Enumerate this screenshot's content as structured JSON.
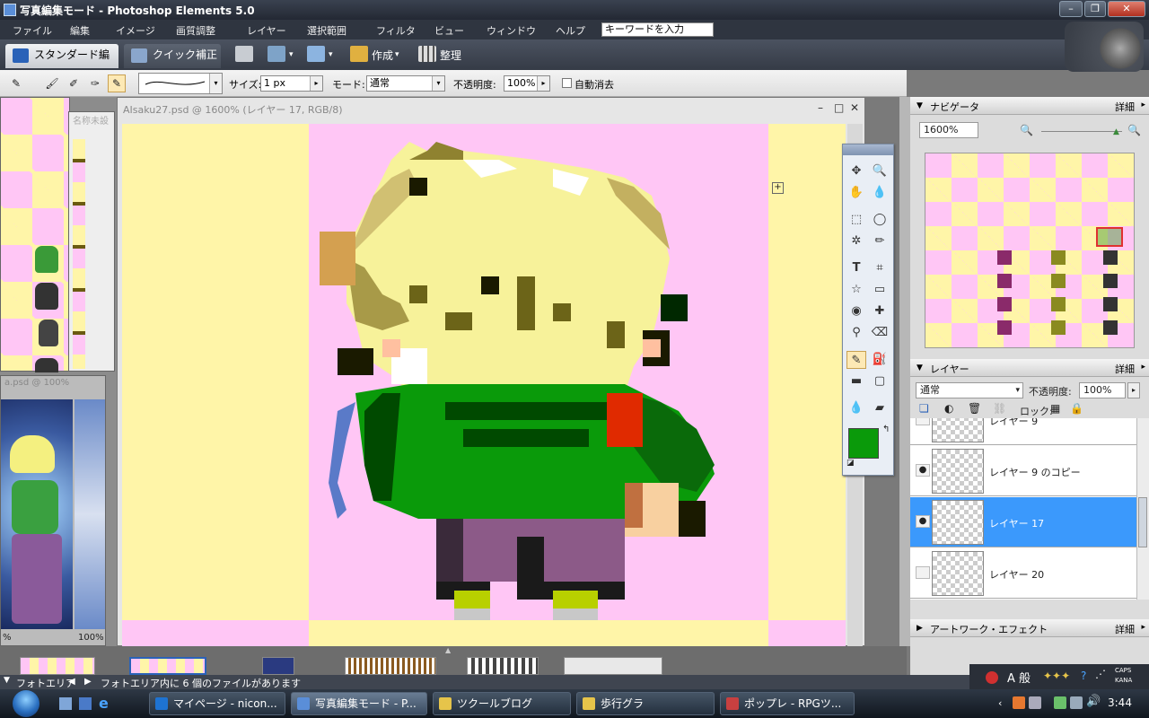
{
  "title_bar": {
    "title": "写真編集モード - Photoshop Elements 5.0"
  },
  "menu": {
    "items": [
      "ファイル",
      "編集",
      "イメージ",
      "画質調整",
      "レイヤー",
      "選択範囲",
      "フィルタ",
      "ビュー",
      "ウィンドウ",
      "ヘルプ"
    ],
    "keyword_placeholder": "キーワードを入力"
  },
  "mode_bar": {
    "standard_tab": "スタンダード編集",
    "quick_tab": "クイック補正",
    "create_label": "作成",
    "organize_label": "整理"
  },
  "options_bar": {
    "size_label": "サイズ:",
    "size_value": "1 px",
    "mode_label": "モード:",
    "mode_value": "通常",
    "opacity_label": "不透明度:",
    "opacity_value": "100%",
    "auto_erase_label": "自動消去"
  },
  "left_windows": {
    "small_title": "名称未設",
    "second_title": "a.psd @ 100%",
    "zoom_left": "%",
    "zoom_right": "100%"
  },
  "document": {
    "title": "AIsaku27.psd @ 1600% (レイヤー 17, RGB/8)"
  },
  "navigator": {
    "title": "ナビゲータ",
    "more": "詳細",
    "zoom": "1600%"
  },
  "layers": {
    "title": "レイヤー",
    "more": "詳細",
    "blend_mode": "通常",
    "opacity_label": "不透明度:",
    "opacity_value": "100%",
    "lock_label": "ロック:",
    "items": [
      {
        "name": "レイヤー 9",
        "visible": false
      },
      {
        "name": "レイヤー 9 のコピー",
        "visible": true
      },
      {
        "name": "レイヤー 17",
        "visible": true
      },
      {
        "name": "レイヤー 20",
        "visible": false
      }
    ]
  },
  "artwork": {
    "title": "アートワーク・エフェクト",
    "more": "詳細"
  },
  "photo_bin": {
    "label": "フォトエリア",
    "status": "フォトエリア内に 6 個のファイルがあります"
  },
  "colors": {
    "foreground": "#0a9a0a",
    "background": "#ffffff",
    "accent": "#3b99fc"
  },
  "taskbar": {
    "items": [
      {
        "label": "マイページ - nicon...",
        "icon": "#1e73d2"
      },
      {
        "label": "写真編集モード - P...",
        "icon": "#5a8ed8"
      },
      {
        "label": "ツクールブログ",
        "icon": "#e6c44a"
      },
      {
        "label": "歩行グラ",
        "icon": "#e6c44a"
      },
      {
        "label": "ポップレ - RPGツ...",
        "icon": "#c84040"
      }
    ],
    "clock": "3:44",
    "ime_label": "A 般",
    "caps": "CAPS",
    "kana": "KANA"
  }
}
